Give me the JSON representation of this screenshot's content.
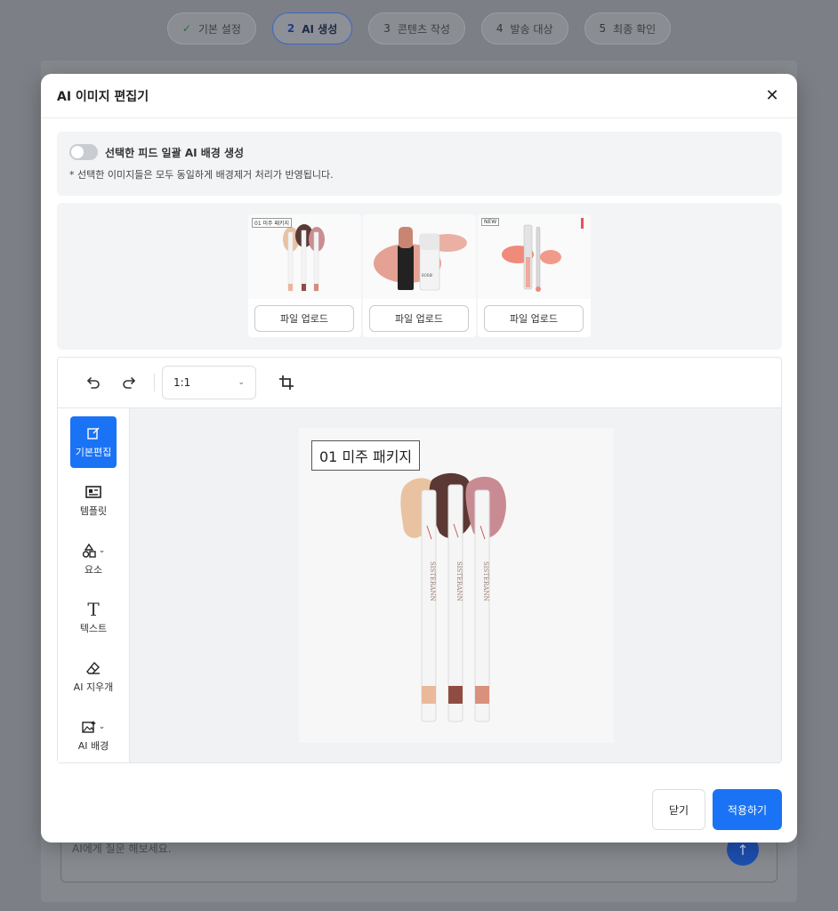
{
  "stepper": {
    "steps": [
      {
        "num": "✓",
        "label": "기본 설정"
      },
      {
        "num": "2",
        "label": "AI 생성"
      },
      {
        "num": "3",
        "label": "콘텐츠 작성"
      },
      {
        "num": "4",
        "label": "발송 대상"
      },
      {
        "num": "5",
        "label": "최종 확인"
      }
    ]
  },
  "background": {
    "chat_placeholder": "AI에게 질문 해보세요."
  },
  "modal": {
    "title": "AI 이미지 편집기",
    "bulk": {
      "toggle_label": "선택한 피드 일괄 AI 배경 생성",
      "note": "* 선택한 이미지들은 모두 동일하게 배경제거 처리가 반영됩니다."
    },
    "thumbnails": [
      {
        "tag": "01 미주 패키지",
        "upload_label": "파일 업로드"
      },
      {
        "tag": "",
        "upload_label": "파일 업로드"
      },
      {
        "tag": "NEW",
        "upload_label": "파일 업로드"
      }
    ],
    "toolbar": {
      "ratio_value": "1:1"
    },
    "tools": [
      {
        "label": "기본편집"
      },
      {
        "label": "템플릿"
      },
      {
        "label": "요소"
      },
      {
        "label": "텍스트"
      },
      {
        "label": "AI 지우개"
      },
      {
        "label": "AI 배경"
      }
    ],
    "canvas": {
      "label": "01 미주 패키지",
      "brand_text": "SISTERANN"
    },
    "buttons": {
      "close": "닫기",
      "apply": "적용하기"
    }
  },
  "colors": {
    "accent": "#1a73f5",
    "overlay": "#7c7f85"
  }
}
